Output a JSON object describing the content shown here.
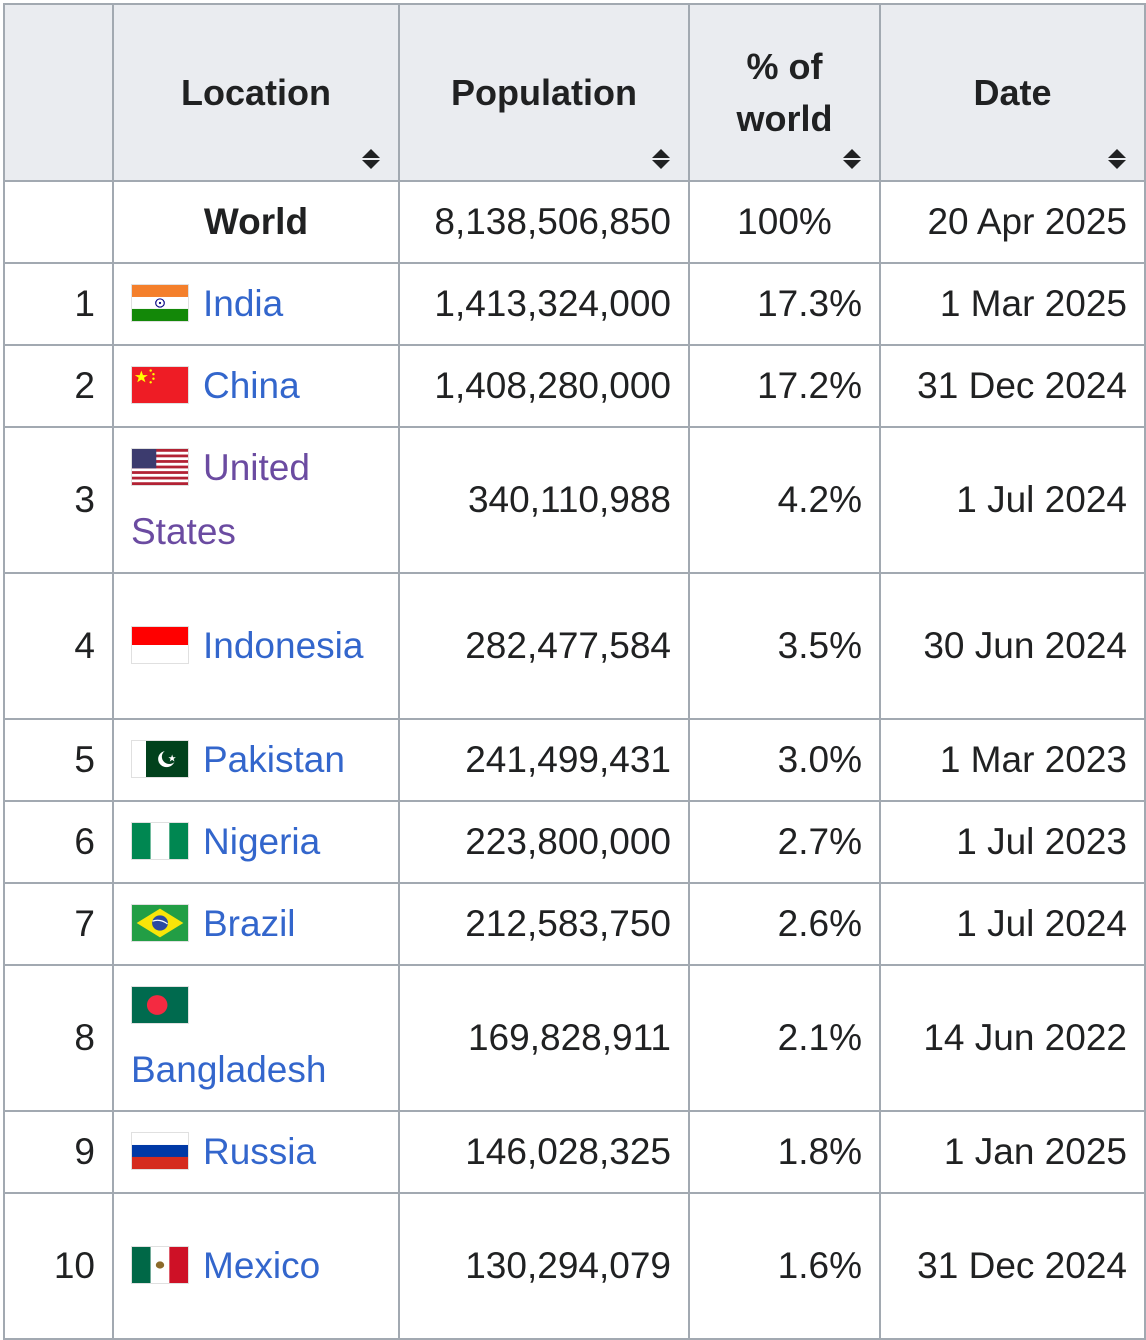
{
  "table": {
    "headers": [
      {
        "key": "rank",
        "label": ""
      },
      {
        "key": "location",
        "label": "Location"
      },
      {
        "key": "population",
        "label": "Population"
      },
      {
        "key": "percent",
        "label": "% of world"
      },
      {
        "key": "date",
        "label": "Date"
      }
    ],
    "world_row": {
      "location": "World",
      "population": "8,138,506,850",
      "percent": "100%",
      "date": "20 Apr 2025"
    },
    "rows": [
      {
        "rank": "1",
        "location": "India",
        "population": "1,413,324,000",
        "percent": "17.3%",
        "date": "1 Mar 2025",
        "flag_icon": "india-flag-icon"
      },
      {
        "rank": "2",
        "location": "China",
        "population": "1,408,280,000",
        "percent": "17.2%",
        "date": "31 Dec 2024",
        "flag_icon": "china-flag-icon"
      },
      {
        "rank": "3",
        "location": "United States",
        "population": "340,110,988",
        "percent": "4.2%",
        "date": "1 Jul 2024",
        "flag_icon": "united-states-flag-icon"
      },
      {
        "rank": "4",
        "location": "Indonesia",
        "population": "282,477,584",
        "percent": "3.5%",
        "date": "30 Jun 2024",
        "flag_icon": "indonesia-flag-icon"
      },
      {
        "rank": "5",
        "location": "Pakistan",
        "population": "241,499,431",
        "percent": "3.0%",
        "date": "1 Mar 2023",
        "flag_icon": "pakistan-flag-icon"
      },
      {
        "rank": "6",
        "location": "Nigeria",
        "population": "223,800,000",
        "percent": "2.7%",
        "date": "1 Jul 2023",
        "flag_icon": "nigeria-flag-icon"
      },
      {
        "rank": "7",
        "location": "Brazil",
        "population": "212,583,750",
        "percent": "2.6%",
        "date": "1 Jul 2024",
        "flag_icon": "brazil-flag-icon"
      },
      {
        "rank": "8",
        "location": "Bangladesh",
        "population": "169,828,911",
        "percent": "2.1%",
        "date": "14 Jun 2022",
        "flag_icon": "bangladesh-flag-icon"
      },
      {
        "rank": "9",
        "location": "Russia",
        "population": "146,028,325",
        "percent": "1.8%",
        "date": "1 Jan 2025",
        "flag_icon": "russia-flag-icon"
      },
      {
        "rank": "10",
        "location": "Mexico",
        "population": "130,294,079",
        "percent": "1.6%",
        "date": "31 Dec 2024",
        "flag_icon": "mexico-flag-icon"
      }
    ]
  },
  "colors": {
    "link": "#3366cc",
    "visited_link": "#6b4ba1",
    "header_bg": "#eaecf0",
    "border": "#a2a9b1",
    "text": "#202122"
  }
}
